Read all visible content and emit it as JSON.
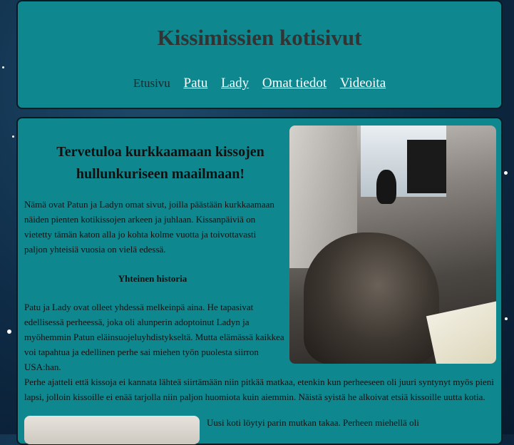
{
  "header": {
    "title": "Kissimissien kotisivut",
    "nav": {
      "current": "Etusivu",
      "links": [
        "Patu",
        "Lady",
        "Omat tiedot",
        "Videoita"
      ]
    }
  },
  "main": {
    "heading": "Tervetuloa kurkkaamaan kissojen hullunkuriseen maailmaan!",
    "intro": "Nämä ovat Patun ja Ladyn omat sivut, joilla päästään kurkkaamaan näiden pienten kotikissojen arkeen ja juhlaan. Kissanpäiviä on vietetty tämän katon alla jo kohta kolme vuotta ja toivottavasti paljon yhteisiä vuosia on vielä edessä.",
    "history_heading": "Yhteinen historia",
    "history_p1": "Patu ja Lady ovat olleet yhdessä melkeinpä aina. He tapasivat edellisessä perheessä, joka oli alunperin adoptoinut Ladyn ja myöhemmin Patun eläinsuojeluyhdistykseltä. Mutta elämässä kaikkea voi tapahtua ja edellinen perhe sai miehen työn puolesta siirron USA:han.",
    "history_p2": "Perhe ajatteli että kissoja ei kannata lähteä siirtämään niin pitkää matkaa, etenkin kun perheeseen oli juuri syntynyt myös pieni lapsi, jolloin kissoille ei enää tarjolla niin paljon huomiota kuin aiemmin. Näistä syistä he alkoivat etsiä kissoille uutta kotia.",
    "home_p": "Uusi koti löytyi parin mutkan takaa. Perheen miehellä oli"
  },
  "colors": {
    "panel": "#0e878e",
    "background": "#0e2a44",
    "heading_text": "#333333",
    "link": "#ffffff"
  }
}
